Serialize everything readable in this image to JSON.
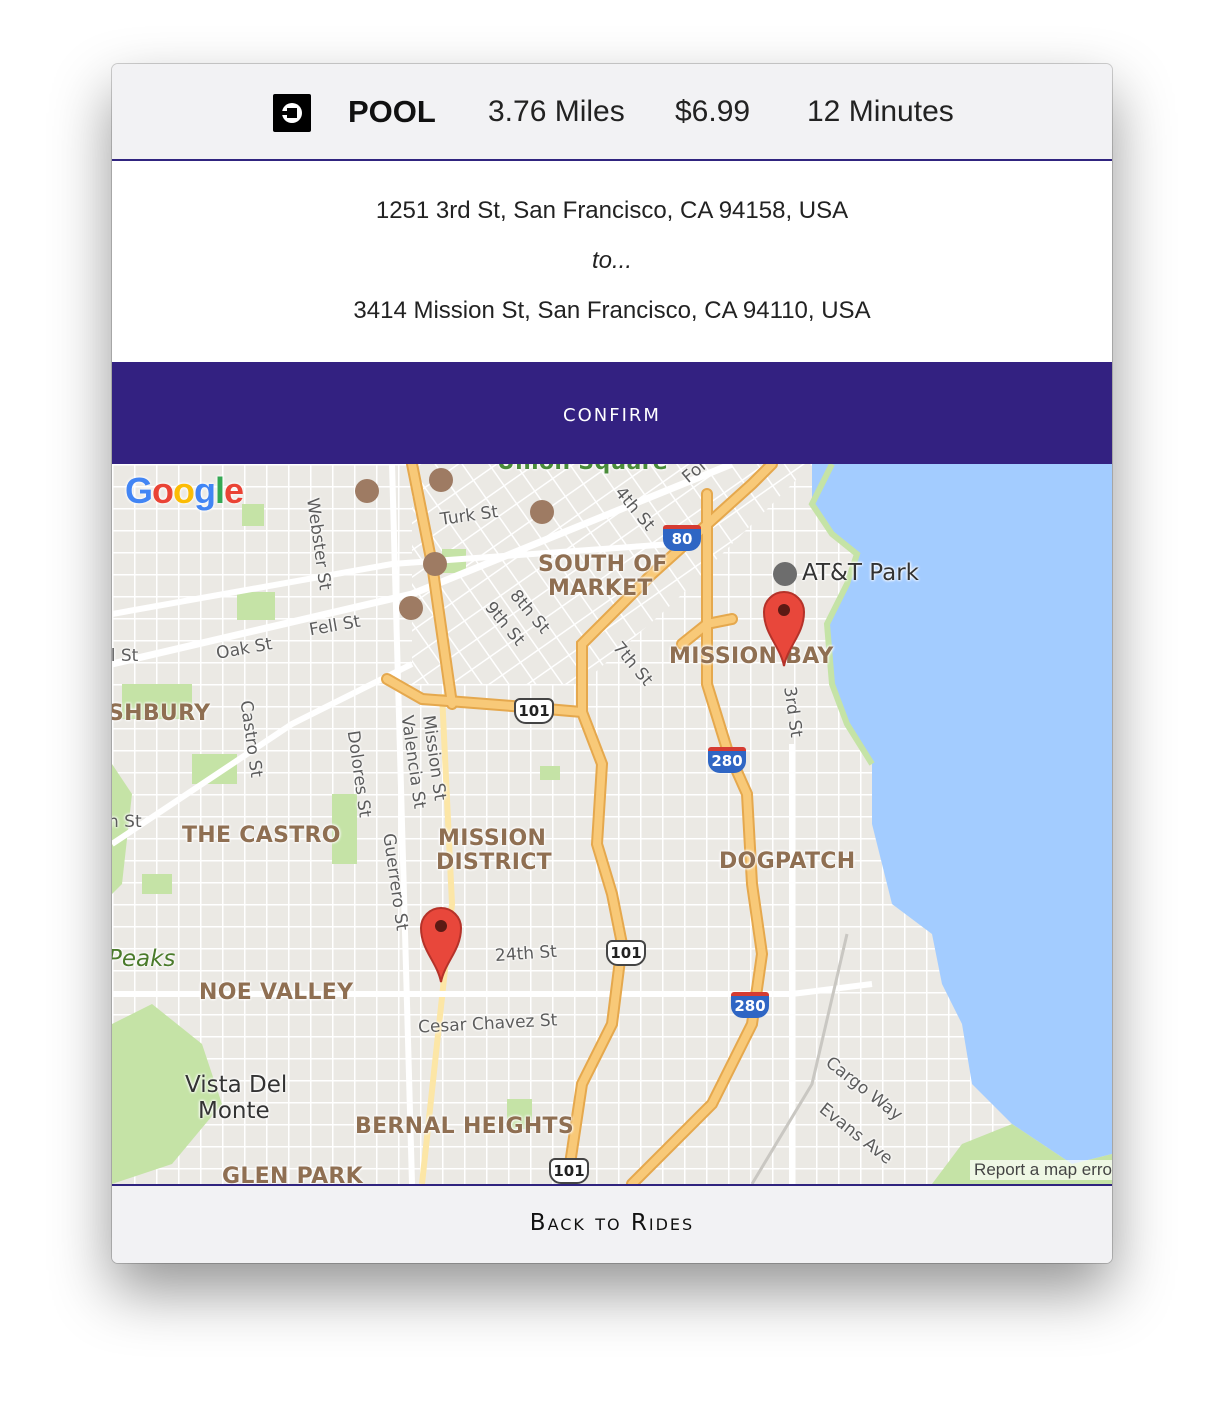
{
  "header": {
    "ride_type": "POOL",
    "distance": "3.76 Miles",
    "price": "$6.99",
    "duration": "12 Minutes",
    "logo_icon": "uber-logo-icon"
  },
  "trip": {
    "origin": "1251 3rd St, San Francisco, CA 94158, USA",
    "connector": "to...",
    "destination": "3414 Mission St, San Francisco, CA 94110, USA"
  },
  "actions": {
    "confirm_label": "confirm",
    "back_label": "Back to Rides"
  },
  "map": {
    "attribution": "Google",
    "report_link": "Report a map erro",
    "neighborhoods": [
      "SOUTH OF",
      "MARKET",
      "MISSION BAY",
      "SHBURY",
      "THE CASTRO",
      "MISSION",
      "DISTRICT",
      "DOGPATCH",
      "NOE VALLEY",
      "BERNAL HEIGHTS",
      "GLEN PARK",
      "Vista Del",
      "Monte",
      "Peaks",
      "Union Square"
    ],
    "streets": [
      "Turk St",
      "4th St",
      "Webster St",
      "Fell St",
      "Oak St",
      "8th St",
      "9th St",
      "7th St",
      "Castro St",
      "Dolores St",
      "Valencia St",
      "Mission St",
      "Guerrero St",
      "3rd St",
      "24th St",
      "Cesar Chavez St",
      "Cargo Way",
      "Evans Ave",
      "ll St",
      "n St",
      "Fol"
    ],
    "places": [
      "AT&T Park"
    ],
    "highways": [
      "80",
      "101",
      "280",
      "101",
      "280",
      "101"
    ],
    "colors": {
      "water": "#a3ccff",
      "land": "#ebe9e4",
      "park": "#c5e3a6",
      "highway": "#f8c978",
      "highway_outline": "#e5a84d",
      "pin": "#e8473b",
      "accent": "#332181"
    }
  }
}
